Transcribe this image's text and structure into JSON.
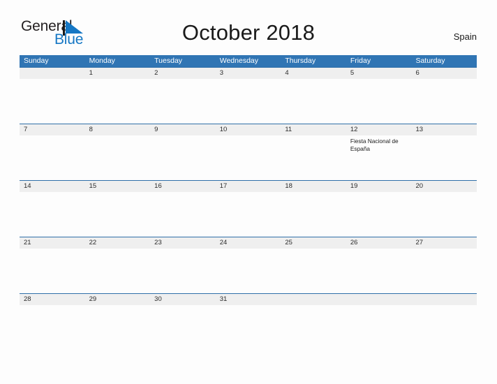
{
  "brand": {
    "name_line1": "General",
    "name_line2": "Blue",
    "mark_icon": "blue-triangle-flag-icon",
    "accent_color": "#1577c4"
  },
  "header": {
    "title": "October 2018",
    "country": "Spain"
  },
  "colors": {
    "header_blue": "#3075b4",
    "row_border_blue": "#2f6fa8",
    "day_band_gray": "#efefef",
    "page_background": "#fdfdfd",
    "text": "#1a1a1a"
  },
  "calendar": {
    "month": "October",
    "year": "2018",
    "weekday_headers": [
      "Sunday",
      "Monday",
      "Tuesday",
      "Wednesday",
      "Thursday",
      "Friday",
      "Saturday"
    ],
    "weeks": [
      [
        {
          "num": "",
          "event": ""
        },
        {
          "num": "1",
          "event": ""
        },
        {
          "num": "2",
          "event": ""
        },
        {
          "num": "3",
          "event": ""
        },
        {
          "num": "4",
          "event": ""
        },
        {
          "num": "5",
          "event": ""
        },
        {
          "num": "6",
          "event": ""
        }
      ],
      [
        {
          "num": "7",
          "event": ""
        },
        {
          "num": "8",
          "event": ""
        },
        {
          "num": "9",
          "event": ""
        },
        {
          "num": "10",
          "event": ""
        },
        {
          "num": "11",
          "event": ""
        },
        {
          "num": "12",
          "event": "Fiesta Nacional de España"
        },
        {
          "num": "13",
          "event": ""
        }
      ],
      [
        {
          "num": "14",
          "event": ""
        },
        {
          "num": "15",
          "event": ""
        },
        {
          "num": "16",
          "event": ""
        },
        {
          "num": "17",
          "event": ""
        },
        {
          "num": "18",
          "event": ""
        },
        {
          "num": "19",
          "event": ""
        },
        {
          "num": "20",
          "event": ""
        }
      ],
      [
        {
          "num": "21",
          "event": ""
        },
        {
          "num": "22",
          "event": ""
        },
        {
          "num": "23",
          "event": ""
        },
        {
          "num": "24",
          "event": ""
        },
        {
          "num": "25",
          "event": ""
        },
        {
          "num": "26",
          "event": ""
        },
        {
          "num": "27",
          "event": ""
        }
      ],
      [
        {
          "num": "28",
          "event": ""
        },
        {
          "num": "29",
          "event": ""
        },
        {
          "num": "30",
          "event": ""
        },
        {
          "num": "31",
          "event": ""
        },
        {
          "num": "",
          "event": ""
        },
        {
          "num": "",
          "event": ""
        },
        {
          "num": "",
          "event": ""
        }
      ]
    ]
  }
}
